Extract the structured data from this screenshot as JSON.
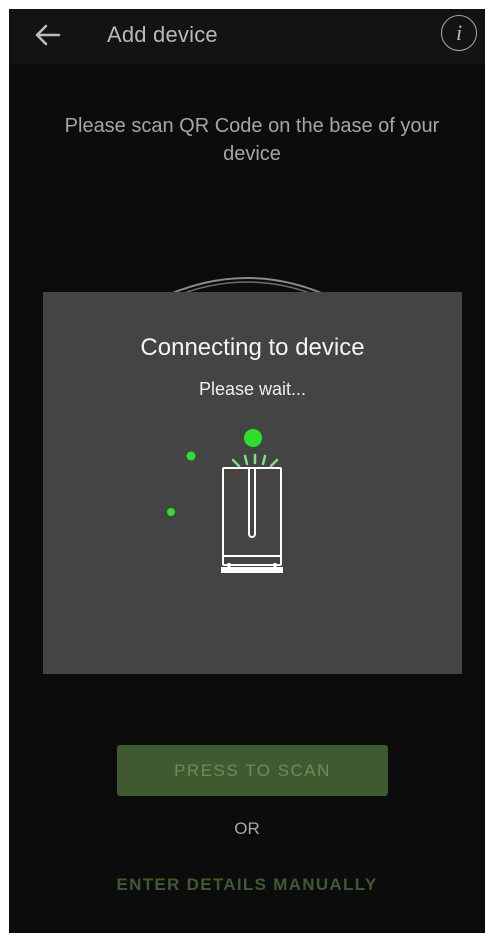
{
  "header": {
    "title": "Add device",
    "back_icon": "arrow-left-icon",
    "info_label": "i",
    "info_icon": "info-icon"
  },
  "main": {
    "instruction": "Please scan QR Code on the base of your device"
  },
  "dialog": {
    "title": "Connecting to device",
    "subtitle": "Please wait..."
  },
  "actions": {
    "scan_button": "PRESS TO SCAN",
    "separator": "OR",
    "manual_link": "ENTER DETAILS MANUALLY"
  },
  "colors": {
    "screen_bg": "#0c0c0c",
    "dialog_bg": "#444444",
    "accent_green": "#2ee02e",
    "button_bg": "#3f5a30",
    "button_text": "#6b8d56"
  }
}
